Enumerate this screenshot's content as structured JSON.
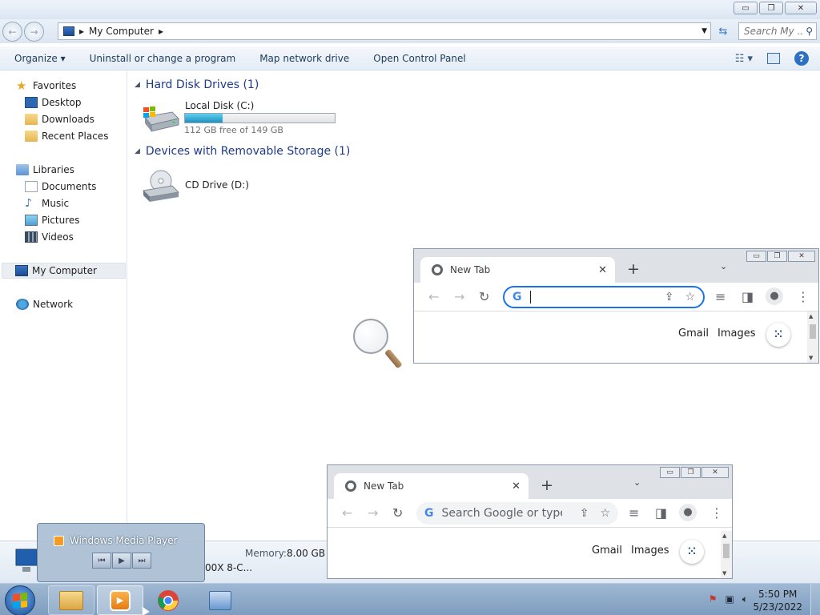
{
  "explorer": {
    "window_controls": {
      "minimize": "▭",
      "maximize": "❐",
      "close": "✕"
    },
    "nav": {
      "back": "←",
      "forward": "→"
    },
    "address": {
      "path": "My Computer",
      "separator": "▸"
    },
    "search_placeholder": "Search My ...",
    "toolbar": {
      "organize": "Organize ▾",
      "uninstall": "Uninstall or change a program",
      "map_drive": "Map network drive",
      "control_panel": "Open Control Panel",
      "help": "?"
    },
    "sidebar": {
      "favorites": "Favorites",
      "desktop": "Desktop",
      "downloads": "Downloads",
      "recent_places": "Recent Places",
      "libraries": "Libraries",
      "documents": "Documents",
      "music": "Music",
      "pictures": "Pictures",
      "videos": "Videos",
      "my_computer": "My Computer",
      "network": "Network"
    },
    "groups": {
      "hdd_title": "Hard Disk Drives (1)",
      "removable_title": "Devices with Removable Storage (1)"
    },
    "drives": {
      "local_disk": {
        "name": "Local Disk (C:)",
        "free_text": "112 GB free of 149 GB",
        "used_fraction": 0.25
      },
      "cd_drive": {
        "name": "CD Drive (D:)"
      }
    },
    "details": {
      "memory_label": "Memory:",
      "memory_value": "8.00 GB",
      "processor_fragment": "00X 8-C..."
    }
  },
  "chrome_windows": [
    {
      "tab_title": "New Tab",
      "tab_close": "✕",
      "new_tab": "+",
      "tab_menu": "⌄",
      "omnibox_text": "",
      "links": {
        "gmail": "Gmail",
        "images": "Images"
      }
    },
    {
      "tab_title": "New Tab",
      "tab_close": "✕",
      "new_tab": "+",
      "tab_menu": "⌄",
      "omnibox_placeholder": "Search Google or type...",
      "links": {
        "gmail": "Gmail",
        "images": "Images"
      }
    }
  ],
  "wmp_thumbnail": {
    "title": "Windows Media Player",
    "prev": "⏮",
    "play": "▶",
    "next": "⏭"
  },
  "taskbar": {
    "time": "5:50 PM",
    "date": "5/23/2022"
  },
  "colors": {
    "accent": "#1a73e8",
    "explorer_link": "#1e3a8a",
    "disk_bar": "#1e8fc0"
  }
}
